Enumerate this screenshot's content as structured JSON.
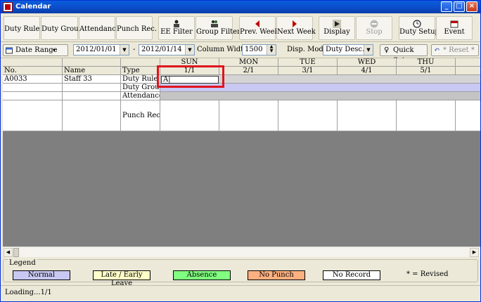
{
  "window": {
    "title": "Calendar"
  },
  "toolbar": {
    "duty_rule": "Duty Rule",
    "duty_group": "Duty Group",
    "attendance": "Attendance",
    "punch_rec": "Punch Rec.",
    "ee_filter": "EE Filter",
    "group_filter": "Group Filter",
    "prev_week": "Prev. Week",
    "next_week": "Next Week",
    "display": "Display",
    "stop": "Stop",
    "duty_setup": "Duty Setup",
    "event": "Event"
  },
  "filter": {
    "date_range_label": "Date Range",
    "start_date": "2012/01/01",
    "dash": "-",
    "end_date": "2012/01/14",
    "column_width_label": "Column Width",
    "column_width": "1500",
    "disp_mode_label": "Disp. Mode",
    "disp_mode": "Duty Desc.",
    "quick_set": "Quick Set",
    "reset": "* Reset *"
  },
  "grid": {
    "left_headers": {
      "no": "No.",
      "name": "Name",
      "type": "Type"
    },
    "days": [
      {
        "dow": "SUN",
        "date": "1/1"
      },
      {
        "dow": "MON",
        "date": "2/1"
      },
      {
        "dow": "TUE",
        "date": "3/1"
      },
      {
        "dow": "WED",
        "date": "4/1"
      },
      {
        "dow": "THU",
        "date": "5/1"
      }
    ],
    "row": {
      "no": "A0033",
      "name": "Staff 33",
      "types": [
        "Duty Rule",
        "Duty Group",
        "Attendance",
        "Punch Rec."
      ],
      "edit_value": "A|"
    }
  },
  "legend": {
    "title": "Legend",
    "items": [
      {
        "label": "Normal",
        "color": "#c8c8f2"
      },
      {
        "label": "Late / Early Leave",
        "color": "#ffffc8"
      },
      {
        "label": "Absence",
        "color": "#80ff80"
      },
      {
        "label": "No Punch",
        "color": "#ffb080"
      },
      {
        "label": "No Record",
        "color": "#ffffff"
      }
    ],
    "revised_note": "* = Revised"
  },
  "status": {
    "text": "Loading...1/1"
  }
}
